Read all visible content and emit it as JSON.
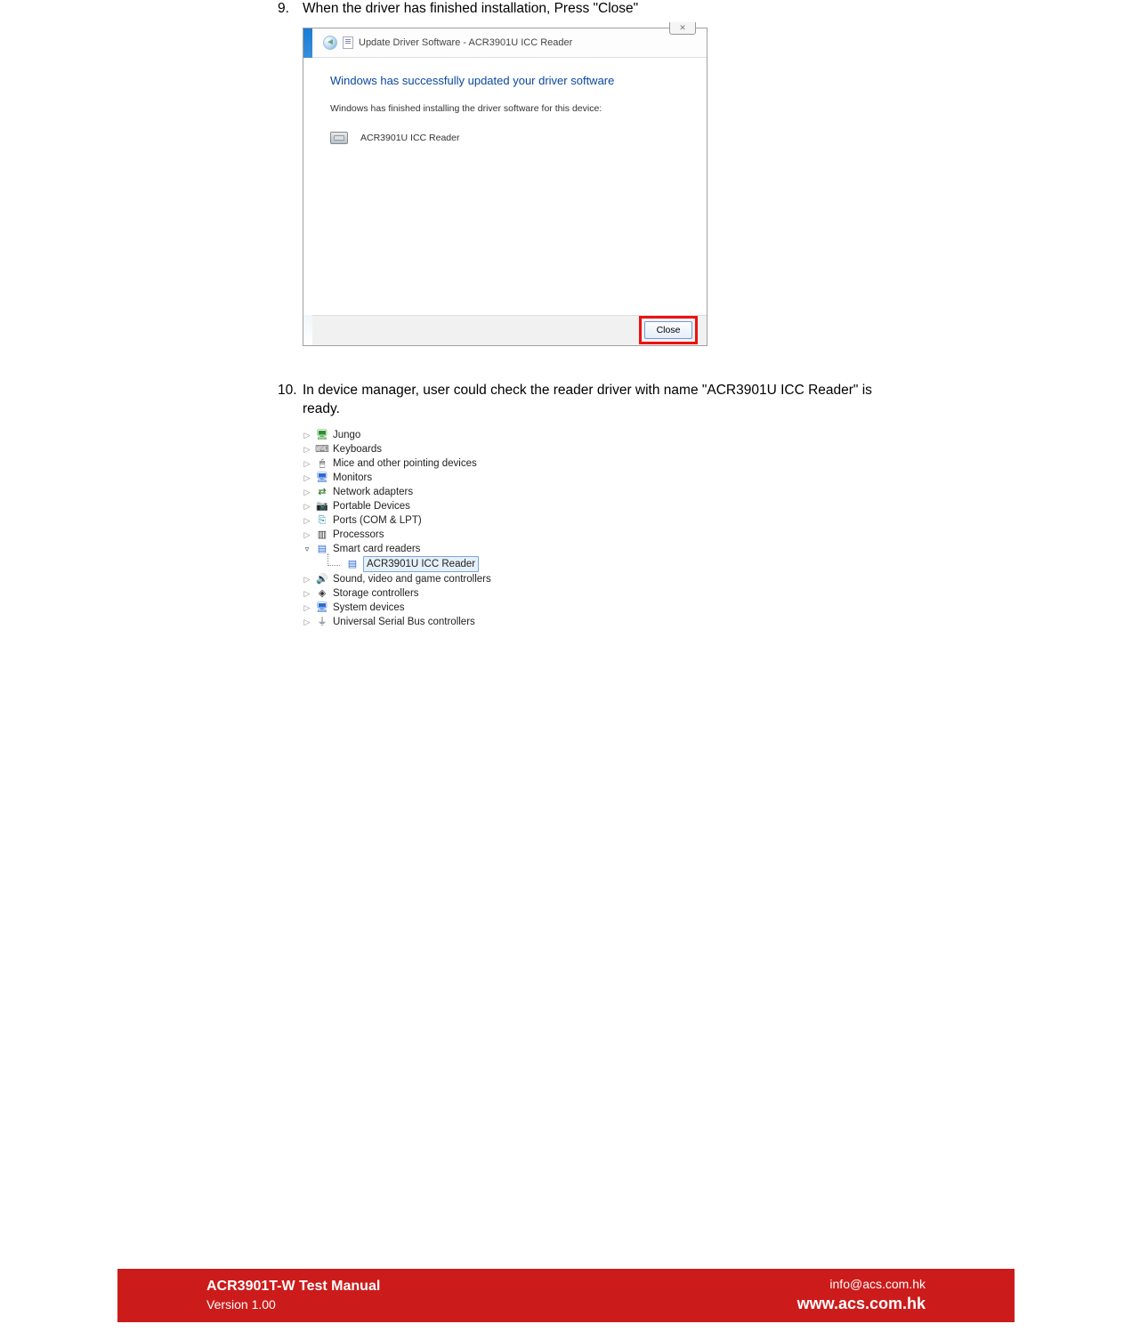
{
  "step9": {
    "num": "9.",
    "text": "When the driver has finished installation, Press \"Close\""
  },
  "dialog": {
    "close_tab": "✕",
    "header_text": "Update Driver Software - ACR3901U ICC Reader",
    "success_title": "Windows has successfully updated your driver software",
    "sub_text": "Windows has finished installing the driver software for this device:",
    "device_name": "ACR3901U ICC Reader",
    "close_button": "Close"
  },
  "step10": {
    "num": "10.",
    "text": "In device manager, user could check the reader driver with name \"ACR3901U ICC Reader\" is ready."
  },
  "tree": {
    "jungo": "Jungo",
    "keyboards": "Keyboards",
    "mice": "Mice and other pointing devices",
    "monitors": "Monitors",
    "network": "Network adapters",
    "portable": "Portable Devices",
    "ports": "Ports (COM & LPT)",
    "processors": "Processors",
    "smart": "Smart card readers",
    "smart_child": "ACR3901U ICC Reader",
    "sound": "Sound, video and game controllers",
    "storage": "Storage controllers",
    "system": "System devices",
    "usb": "Universal Serial Bus controllers"
  },
  "footer": {
    "title": "ACR3901T-W Test Manual",
    "version": "Version 1.00",
    "email": "info@acs.com.hk",
    "url": "www.acs.com.hk"
  }
}
